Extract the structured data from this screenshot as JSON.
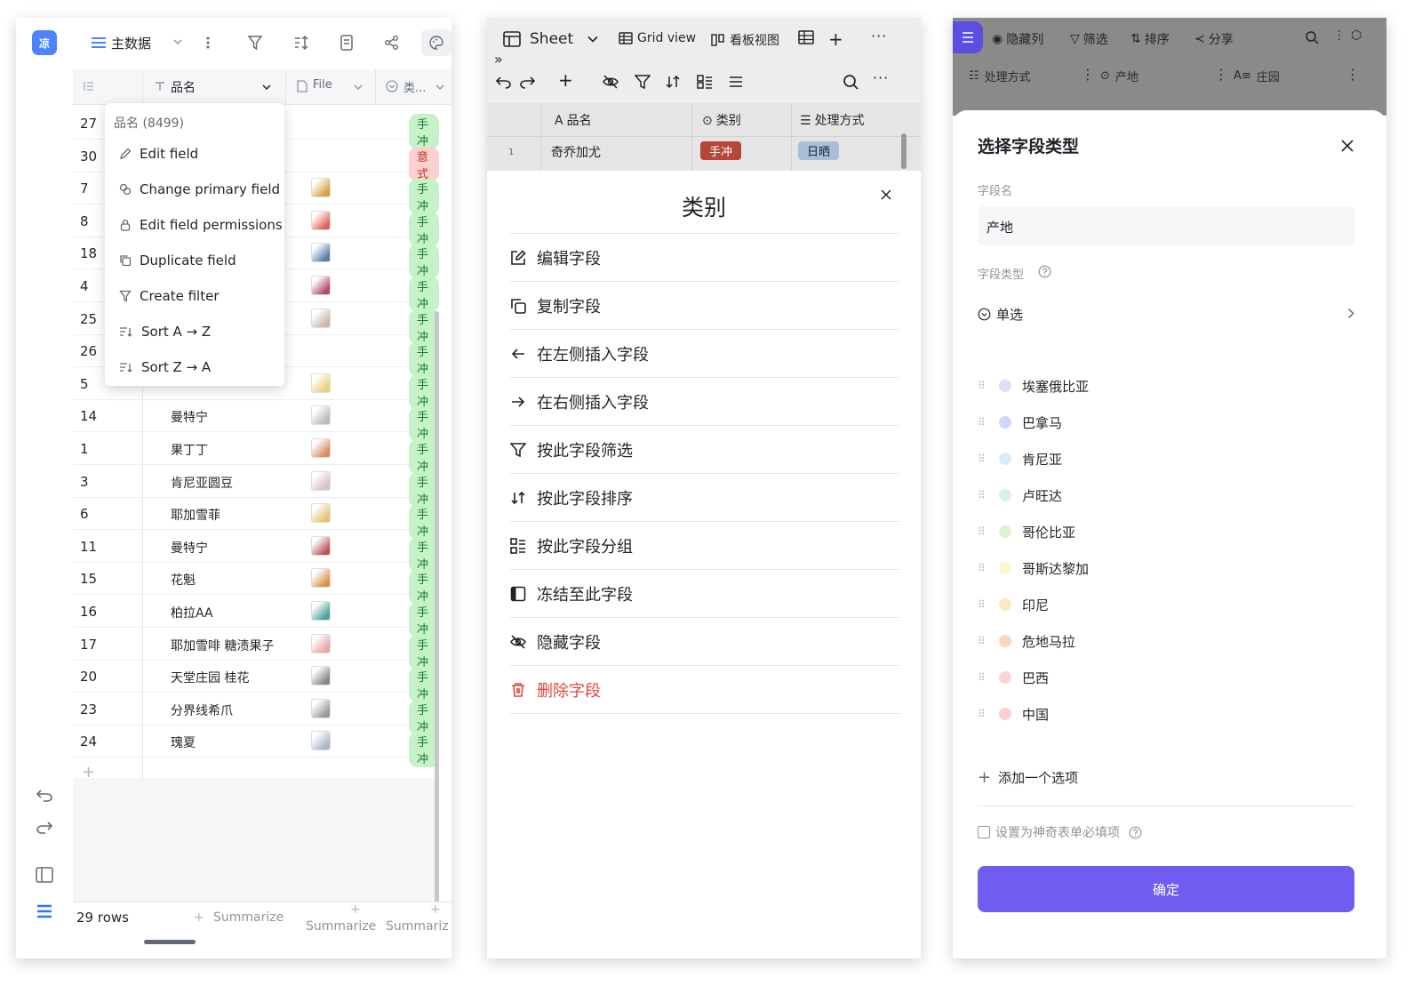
{
  "p1": {
    "logo": "凉",
    "view_name": "主数据",
    "col_name": "品名",
    "col_file": "File",
    "col_cat": "类...",
    "menu": {
      "title": "品名 (8499)",
      "items": [
        "Edit field",
        "Change primary field",
        "Edit field permissions",
        "Duplicate field",
        "Create filter",
        "Sort A → Z",
        "Sort Z → A"
      ]
    },
    "rows": [
      {
        "n": "27",
        "name": "",
        "tag": "手冲"
      },
      {
        "n": "30",
        "name": "",
        "tag": "意式"
      },
      {
        "n": "7",
        "name": "",
        "tag": "手冲"
      },
      {
        "n": "8",
        "name": "",
        "tag": "手冲"
      },
      {
        "n": "18",
        "name": "",
        "tag": "手冲"
      },
      {
        "n": "4",
        "name": "",
        "tag": "手冲"
      },
      {
        "n": "25",
        "name": "",
        "tag": "手冲"
      },
      {
        "n": "26",
        "name": "",
        "tag": "手冲"
      },
      {
        "n": "5",
        "name": "",
        "tag": "手冲"
      },
      {
        "n": "14",
        "name": "曼特宁",
        "tag": "手冲"
      },
      {
        "n": "1",
        "name": "果丁丁",
        "tag": "手冲"
      },
      {
        "n": "3",
        "name": "肯尼亚圆豆",
        "tag": "手冲"
      },
      {
        "n": "6",
        "name": "耶加雪菲",
        "tag": "手冲"
      },
      {
        "n": "11",
        "name": "曼特宁",
        "tag": "手冲"
      },
      {
        "n": "15",
        "name": "花魁",
        "tag": "手冲"
      },
      {
        "n": "16",
        "name": "柏拉AA",
        "tag": "手冲"
      },
      {
        "n": "17",
        "name": "耶加雪啡 糖渍果子",
        "tag": "手冲"
      },
      {
        "n": "20",
        "name": "天堂庄园 桂花",
        "tag": "手冲"
      },
      {
        "n": "23",
        "name": "分界线希爪",
        "tag": "手冲"
      },
      {
        "n": "24",
        "name": "瑰夏",
        "tag": "手冲"
      }
    ],
    "rows_count": "29 rows",
    "summarize": "Summarize",
    "summarize_trunc": "Summariz"
  },
  "p2": {
    "sheet": "Sheet",
    "grid_view": "Grid view",
    "kanban": "看板视图",
    "col_name": "品名",
    "col_cat": "类别",
    "col_proc": "处理方式",
    "row_num": "1",
    "row_name": "奇乔加尤",
    "row_tag": "手冲",
    "row_proc": "日晒",
    "title": "类别",
    "items": [
      "编辑字段",
      "复制字段",
      "在左侧插入字段",
      "在右侧插入字段",
      "按此字段筛选",
      "按此字段排序",
      "按此字段分组",
      "冻结至此字段",
      "隐藏字段"
    ],
    "delete": "删除字段"
  },
  "p3": {
    "bar": [
      "隐藏列",
      "筛选",
      "排序",
      "分享"
    ],
    "cols": [
      "处理方式",
      "产地",
      "庄园"
    ],
    "title": "选择字段类型",
    "field_name_label": "字段名",
    "field_name_value": "产地",
    "field_type_label": "字段类型",
    "field_type_value": "单选",
    "options": [
      {
        "label": "埃塞俄比亚",
        "color": "#e1dcfb"
      },
      {
        "label": "巴拿马",
        "color": "#cdd6fb"
      },
      {
        "label": "肯尼亚",
        "color": "#d9ecfb"
      },
      {
        "label": "卢旺达",
        "color": "#d3f3e9"
      },
      {
        "label": "哥伦比亚",
        "color": "#ddf5cf"
      },
      {
        "label": "哥斯达黎加",
        "color": "#fdf6cf"
      },
      {
        "label": "印尼",
        "color": "#fde8c4"
      },
      {
        "label": "危地马拉",
        "color": "#fbd8bd"
      },
      {
        "label": "巴西",
        "color": "#fbd3d3"
      },
      {
        "label": "中国",
        "color": "#fccfcf"
      }
    ],
    "add_option": "添加一个选项",
    "required": "设置为神奇表单必填项",
    "confirm": "确定"
  }
}
